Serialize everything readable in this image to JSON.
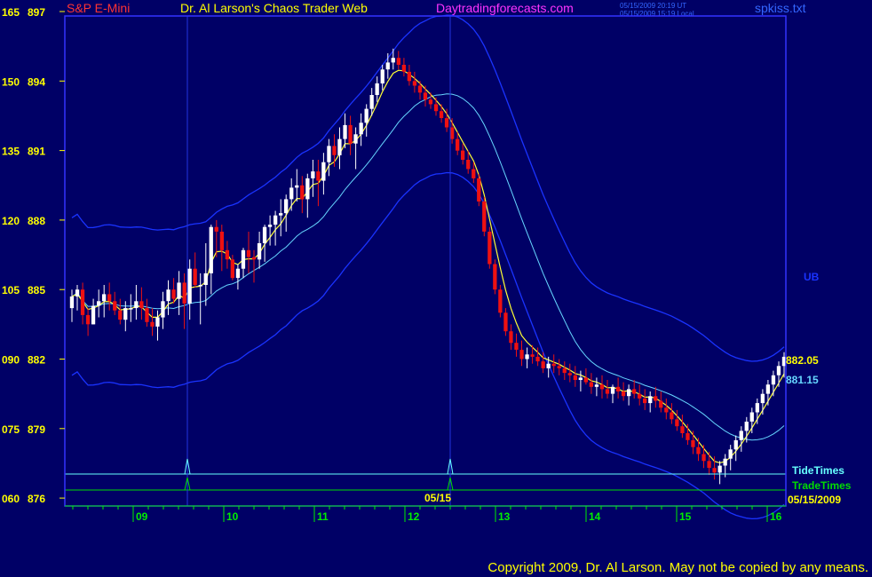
{
  "header": {
    "symbol": "S&P E-Mini",
    "title": "Dr. Al Larson's Chaos Trader Web",
    "site": "Daytradingforecasts.com",
    "stamp_1": "05/15/2009 20:19 UT",
    "stamp_2": "05/15/2009 15:19 Local",
    "file": "spkiss.txt"
  },
  "colors": {
    "background": "#000066",
    "frame": "#3333ff",
    "price_axis": "#ffff00",
    "time_axis": "#00ee00",
    "up_candle": "#ffffff",
    "down_candle": "#ee1111",
    "band_outer": "#1a33ff",
    "band_mid": "#66d6ff",
    "moving_avg": "#ffff33",
    "tide": "#66ffff",
    "trade": "#00dd00",
    "site": "#ff33ff"
  },
  "chart_data": {
    "type": "candlestick",
    "y_axis": {
      "price_min": 875.0,
      "price_max": 897.0,
      "price_ticks": [
        876,
        879,
        882,
        885,
        888,
        891,
        894,
        897
      ],
      "index_ticks": [
        "060",
        "075",
        "090",
        "105",
        "120",
        "135",
        "150",
        "165"
      ]
    },
    "x_axis": {
      "labels": [
        "09",
        "10",
        "11",
        "12",
        "13",
        "14",
        "15",
        "16"
      ],
      "day_tick_x": [
        150,
        252,
        354,
        456,
        558,
        660,
        762,
        864
      ],
      "label_marker": "05/15"
    },
    "candles": [
      [
        884.2,
        885.0,
        883.6,
        884.7
      ],
      [
        884.7,
        885.2,
        884.1,
        885.0
      ],
      [
        885.0,
        885.3,
        883.5,
        883.9
      ],
      [
        883.9,
        884.2,
        883.0,
        883.5
      ],
      [
        883.5,
        884.6,
        883.5,
        884.3
      ],
      [
        884.3,
        885.0,
        883.8,
        884.5
      ],
      [
        884.5,
        885.2,
        883.8,
        884.8
      ],
      [
        884.8,
        885.3,
        884.1,
        884.5
      ],
      [
        884.5,
        884.9,
        883.9,
        884.1
      ],
      [
        884.1,
        884.6,
        883.5,
        883.7
      ],
      [
        883.7,
        884.5,
        883.2,
        884.2
      ],
      [
        884.2,
        884.8,
        883.6,
        884.2
      ],
      [
        884.2,
        885.2,
        883.7,
        884.5
      ],
      [
        884.5,
        885.1,
        883.7,
        884.2
      ],
      [
        884.2,
        884.6,
        883.4,
        883.6
      ],
      [
        883.6,
        884.2,
        883.0,
        883.4
      ],
      [
        883.4,
        884.1,
        882.8,
        883.8
      ],
      [
        883.8,
        884.9,
        883.3,
        884.5
      ],
      [
        884.5,
        885.4,
        883.9,
        885.0
      ],
      [
        885.0,
        885.5,
        884.4,
        884.6
      ],
      [
        884.6,
        885.8,
        883.9,
        885.3
      ],
      [
        885.3,
        885.7,
        883.3,
        884.4
      ],
      [
        884.4,
        886.3,
        883.7,
        885.9
      ],
      [
        885.9,
        886.6,
        885.1,
        885.2
      ],
      [
        885.2,
        885.7,
        883.5,
        885.2
      ],
      [
        885.2,
        887.0,
        884.3,
        885.7
      ],
      [
        885.7,
        887.8,
        884.8,
        887.7
      ],
      [
        887.7,
        888.0,
        886.4,
        887.5
      ],
      [
        887.5,
        887.8,
        885.8,
        886.7
      ],
      [
        886.7,
        887.1,
        885.9,
        886.3
      ],
      [
        886.3,
        886.5,
        885.4,
        885.5
      ],
      [
        885.5,
        886.1,
        885.0,
        885.9
      ],
      [
        885.9,
        886.8,
        885.5,
        886.7
      ],
      [
        886.7,
        887.5,
        885.7,
        886.4
      ],
      [
        886.4,
        886.7,
        885.3,
        886.3
      ],
      [
        886.3,
        887.5,
        885.9,
        887.0
      ],
      [
        887.0,
        887.8,
        886.2,
        887.7
      ],
      [
        887.7,
        888.2,
        886.9,
        887.8
      ],
      [
        887.8,
        888.4,
        886.9,
        888.2
      ],
      [
        888.2,
        888.9,
        887.3,
        888.3
      ],
      [
        888.3,
        889.1,
        887.5,
        888.9
      ],
      [
        888.9,
        889.8,
        888.4,
        889.4
      ],
      [
        889.4,
        890.2,
        888.8,
        889.5
      ],
      [
        889.5,
        889.9,
        888.3,
        888.9
      ],
      [
        888.9,
        890.0,
        888.1,
        889.8
      ],
      [
        889.8,
        890.6,
        889.0,
        890.1
      ],
      [
        890.1,
        890.6,
        888.6,
        889.7
      ],
      [
        889.7,
        890.9,
        889.1,
        890.5
      ],
      [
        890.5,
        891.5,
        889.9,
        891.2
      ],
      [
        891.2,
        891.7,
        890.3,
        890.8
      ],
      [
        890.8,
        892.0,
        890.2,
        891.5
      ],
      [
        891.5,
        892.6,
        891.1,
        892.1
      ],
      [
        892.1,
        892.5,
        890.8,
        891.3
      ],
      [
        891.3,
        892.0,
        890.2,
        891.7
      ],
      [
        891.7,
        892.6,
        891.2,
        892.2
      ],
      [
        892.2,
        893.0,
        891.6,
        892.8
      ],
      [
        892.8,
        893.7,
        892.5,
        893.4
      ],
      [
        893.4,
        894.2,
        893.1,
        893.9
      ],
      [
        893.9,
        894.7,
        893.6,
        894.5
      ],
      [
        894.5,
        895.2,
        894.1,
        894.8
      ],
      [
        894.8,
        895.4,
        894.5,
        895.0
      ],
      [
        895.0,
        895.3,
        894.5,
        894.7
      ],
      [
        894.7,
        895.0,
        894.2,
        894.4
      ],
      [
        894.4,
        894.7,
        893.8,
        894.0
      ],
      [
        894.0,
        894.4,
        893.5,
        893.8
      ],
      [
        893.8,
        894.0,
        893.2,
        893.5
      ],
      [
        893.5,
        893.8,
        892.9,
        893.2
      ],
      [
        893.2,
        893.5,
        892.8,
        893.0
      ],
      [
        893.0,
        893.3,
        892.5,
        892.7
      ],
      [
        892.7,
        893.0,
        892.2,
        892.4
      ],
      [
        892.4,
        892.8,
        891.8,
        892.0
      ],
      [
        892.0,
        892.4,
        891.3,
        891.5
      ],
      [
        891.5,
        891.8,
        890.8,
        891.0
      ],
      [
        891.0,
        891.3,
        890.4,
        890.6
      ],
      [
        890.6,
        891.0,
        890.0,
        890.2
      ],
      [
        890.2,
        890.5,
        889.6,
        889.8
      ],
      [
        889.8,
        890.0,
        888.6,
        888.8
      ],
      [
        888.8,
        889.0,
        887.3,
        887.5
      ],
      [
        887.5,
        887.7,
        885.9,
        886.1
      ],
      [
        886.1,
        886.3,
        884.8,
        885.0
      ],
      [
        885.0,
        885.2,
        883.8,
        884.0
      ],
      [
        884.0,
        884.2,
        883.0,
        883.2
      ],
      [
        883.2,
        883.5,
        882.4,
        882.7
      ],
      [
        882.7,
        883.1,
        882.1,
        882.4
      ],
      [
        882.4,
        882.8,
        881.7,
        882.0
      ],
      [
        882.0,
        882.5,
        881.6,
        882.2
      ],
      [
        882.2,
        882.6,
        881.8,
        882.1
      ],
      [
        882.1,
        882.5,
        881.7,
        881.9
      ],
      [
        881.9,
        882.3,
        881.4,
        881.6
      ],
      [
        881.6,
        882.1,
        881.2,
        881.8
      ],
      [
        881.8,
        882.2,
        881.4,
        881.7
      ],
      [
        881.7,
        882.0,
        881.3,
        881.6
      ],
      [
        881.6,
        881.9,
        881.1,
        881.4
      ],
      [
        881.4,
        881.8,
        881.0,
        881.3
      ],
      [
        881.3,
        881.7,
        880.8,
        881.1
      ],
      [
        881.1,
        881.5,
        880.6,
        881.2
      ],
      [
        881.2,
        881.6,
        880.9,
        881.0
      ],
      [
        881.0,
        881.4,
        880.5,
        880.8
      ],
      [
        880.8,
        881.2,
        880.4,
        880.9
      ],
      [
        880.9,
        881.3,
        880.3,
        880.7
      ],
      [
        880.7,
        881.1,
        880.3,
        880.5
      ],
      [
        880.5,
        880.9,
        880.1,
        880.8
      ],
      [
        880.8,
        881.2,
        880.3,
        880.6
      ],
      [
        880.6,
        881.0,
        880.2,
        880.4
      ],
      [
        880.4,
        880.9,
        880.0,
        880.7
      ],
      [
        880.7,
        881.1,
        880.3,
        880.5
      ],
      [
        880.5,
        880.9,
        880.0,
        880.3
      ],
      [
        880.3,
        880.7,
        879.8,
        880.1
      ],
      [
        880.1,
        880.6,
        879.7,
        880.4
      ],
      [
        880.4,
        880.8,
        879.9,
        880.2
      ],
      [
        880.2,
        880.6,
        879.7,
        879.9
      ],
      [
        879.9,
        880.3,
        879.4,
        879.7
      ],
      [
        879.7,
        880.1,
        879.2,
        879.4
      ],
      [
        879.4,
        879.8,
        878.9,
        879.1
      ],
      [
        879.1,
        879.6,
        878.6,
        878.8
      ],
      [
        878.8,
        879.2,
        878.3,
        878.5
      ],
      [
        878.5,
        878.9,
        877.9,
        878.2
      ],
      [
        878.2,
        878.6,
        877.6,
        877.9
      ],
      [
        877.9,
        878.3,
        877.3,
        877.6
      ],
      [
        877.6,
        878.0,
        877.0,
        877.3
      ],
      [
        877.3,
        877.8,
        876.8,
        877.1
      ],
      [
        877.1,
        877.6,
        876.6,
        877.4
      ],
      [
        877.4,
        877.9,
        876.9,
        877.7
      ],
      [
        877.7,
        878.3,
        877.2,
        878.1
      ],
      [
        878.1,
        878.7,
        877.6,
        878.5
      ],
      [
        878.5,
        879.1,
        878.0,
        878.9
      ],
      [
        878.9,
        879.5,
        878.4,
        879.3
      ],
      [
        879.3,
        879.9,
        878.8,
        879.7
      ],
      [
        879.7,
        880.3,
        879.2,
        880.1
      ],
      [
        880.1,
        880.7,
        879.6,
        880.5
      ],
      [
        880.5,
        881.1,
        880.0,
        880.9
      ],
      [
        880.9,
        881.5,
        880.4,
        881.3
      ],
      [
        881.3,
        881.9,
        880.8,
        881.7
      ],
      [
        881.7,
        882.3,
        881.2,
        882.1
      ]
    ],
    "moving_average": [],
    "band_outer_upper": [],
    "band_outer_lower": [],
    "band_mid": [],
    "cycle_markers_x": [
      211,
      507
    ],
    "tide_label": "TideTimes",
    "trade_label": "TradeTimes",
    "date_label": "05/15/2009",
    "ub_label": "UB",
    "last_price": "882.05",
    "mid_price": "881.15"
  },
  "footer": {
    "copyright": "Copyright 2009, Dr. Al Larson. May not be copied by any means."
  }
}
